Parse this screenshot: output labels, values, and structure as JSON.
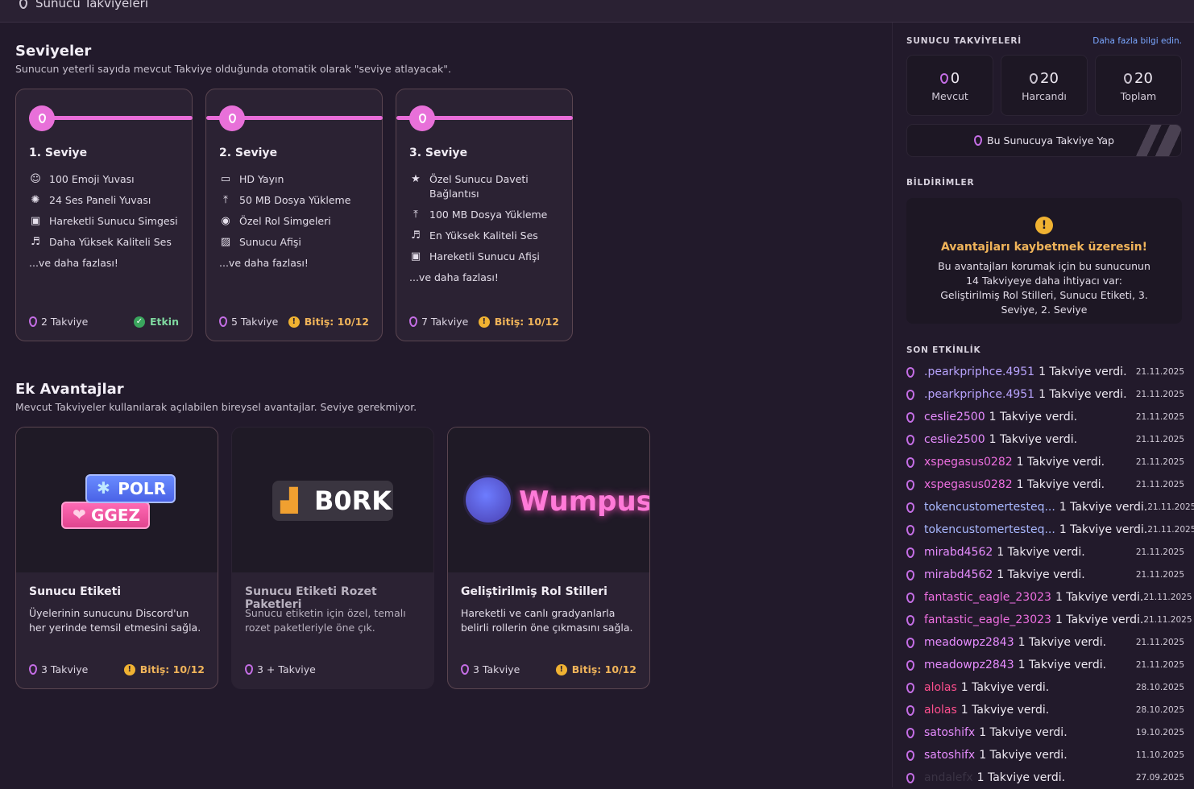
{
  "header": {
    "title": "Sunucu Takviyeleri"
  },
  "levels": {
    "title": "Seviyeler",
    "subtitle": "Sunucun yeterli sayıda mevcut Takviye olduğunda otomatik olarak \"seviye atlayacak\".",
    "cards": [
      {
        "name": "1. Seviye",
        "perks": [
          {
            "icon": "emoji-icon",
            "text": "100 Emoji Yuvası"
          },
          {
            "icon": "soundboard-icon",
            "text": "24 Ses Paneli Yuvası"
          },
          {
            "icon": "gif-icon",
            "text": "Hareketli Sunucu Simgesi"
          },
          {
            "icon": "headphones-icon",
            "text": "Daha Yüksek Kaliteli Ses"
          }
        ],
        "more": "...ve daha fazlası!",
        "boosts": "2 Takviye",
        "status": "Etkin"
      },
      {
        "name": "2. Seviye",
        "perks": [
          {
            "icon": "screen-share-icon",
            "text": "HD Yayın"
          },
          {
            "icon": "upload-icon",
            "text": "50 MB Dosya Yükleme"
          },
          {
            "icon": "role-icon",
            "text": "Özel Rol Simgeleri"
          },
          {
            "icon": "image-icon",
            "text": "Sunucu Afişi"
          }
        ],
        "more": "...ve daha fazlası!",
        "boosts": "5 Takviye",
        "status": "Bitiş: 10/12"
      },
      {
        "name": "3. Seviye",
        "perks": [
          {
            "icon": "star-icon",
            "text": "Özel Sunucu Daveti Bağlantısı"
          },
          {
            "icon": "upload-icon",
            "text": "100 MB Dosya Yükleme"
          },
          {
            "icon": "headphones-icon",
            "text": "En Yüksek Kaliteli Ses"
          },
          {
            "icon": "gif-icon",
            "text": "Hareketli Sunucu Afişi"
          }
        ],
        "more": "...ve daha fazlası!",
        "boosts": "7 Takviye",
        "status": "Bitiş: 10/12"
      }
    ]
  },
  "extras": {
    "title": "Ek Avantajlar",
    "subtitle": "Mevcut Takviyeler kullanılarak açılabilen bireysel avantajlar. Seviye gerekmiyor.",
    "cards": [
      {
        "title": "Sunucu Etiketi",
        "desc": "Üyelerinin sunucunu Discord'un her yerinde temsil etmesini sağla.",
        "boosts": "3 Takviye",
        "status": "Bitiş: 10/12",
        "tag1": "POLR",
        "tag2": "GGEZ"
      },
      {
        "title": "Sunucu Etiketi Rozet Paketleri",
        "desc": "Sunucu etiketin için özel, temalı rozet paketleriyle öne çık.",
        "boosts": "3 + Takviye",
        "tag": "B0RK"
      },
      {
        "title": "Geliştirilmiş Rol Stilleri",
        "desc": "Hareketli ve canlı gradyanlarla belirli rollerin öne çıkmasını sağla.",
        "boosts": "3 Takviye",
        "status": "Bitiş: 10/12",
        "tag": "Wumpus"
      }
    ]
  },
  "sidebar": {
    "boosts_title": "SUNUCU TAKVİYELERİ",
    "learn_more": "Daha fazla bilgi edin.",
    "stats": [
      {
        "value": "0",
        "label": "Mevcut"
      },
      {
        "value": "20",
        "label": "Harcandı"
      },
      {
        "value": "20",
        "label": "Toplam"
      }
    ],
    "boost_button": "Bu Sunucuya Takviye Yap",
    "notif_title": "BİLDİRİMLER",
    "notif_heading": "Avantajları kaybetmek üzeresin!",
    "notif_text": "Bu avantajları korumak için bu sunucunun 14 Takviyeye daha ihtiyacı var: Geliştirilmiş Rol Stilleri, Sunucu Etiketi, 3. Seviye, 2. Seviye",
    "activity_title": "SON ETKİNLİK",
    "activity": [
      {
        "user": ".pearkpriphce.4951",
        "msg": "1 Takviye verdi.",
        "date": "21.11.2025",
        "color": "#b9a4ff"
      },
      {
        "user": ".pearkpriphce.4951",
        "msg": "1 Takviye verdi.",
        "date": "21.11.2025",
        "color": "#b9a4ff"
      },
      {
        "user": "ceslie2500",
        "msg": "1 Takviye verdi.",
        "date": "21.11.2025",
        "color": "#e78cff"
      },
      {
        "user": "ceslie2500",
        "msg": "1 Takviye verdi.",
        "date": "21.11.2025",
        "color": "#e78cff"
      },
      {
        "user": "xspegasus0282",
        "msg": "1 Takviye verdi.",
        "date": "21.11.2025",
        "color": "#ee6fe0"
      },
      {
        "user": "xspegasus0282",
        "msg": "1 Takviye verdi.",
        "date": "21.11.2025",
        "color": "#ee6fe0"
      },
      {
        "user": "tokencustomertesteq...",
        "msg": "1 Takviye verdi.",
        "date": "21.11.2025",
        "color": "#a9b8ff"
      },
      {
        "user": "tokencustomertesteq...",
        "msg": "1 Takviye verdi.",
        "date": "21.11.2025",
        "color": "#a9b8ff"
      },
      {
        "user": "mirabd4562",
        "msg": "1 Takviye verdi.",
        "date": "21.11.2025",
        "color": "#e78cff"
      },
      {
        "user": "mirabd4562",
        "msg": "1 Takviye verdi.",
        "date": "21.11.2025",
        "color": "#e78cff"
      },
      {
        "user": "fantastic_eagle_23023",
        "msg": "1 Takviye verdi.",
        "date": "21.11.2025",
        "color": "#ee6fe0"
      },
      {
        "user": "fantastic_eagle_23023",
        "msg": "1 Takviye verdi.",
        "date": "21.11.2025",
        "color": "#ee6fe0"
      },
      {
        "user": "meadowpz2843",
        "msg": "1 Takviye verdi.",
        "date": "21.11.2025",
        "color": "#e78cff"
      },
      {
        "user": "meadowpz2843",
        "msg": "1 Takviye verdi.",
        "date": "21.11.2025",
        "color": "#e78cff"
      },
      {
        "user": "alolas",
        "msg": "1 Takviye verdi.",
        "date": "28.10.2025",
        "color": "#ff4f8e"
      },
      {
        "user": "alolas",
        "msg": "1 Takviye verdi.",
        "date": "28.10.2025",
        "color": "#ff4f8e"
      },
      {
        "user": "satoshifx",
        "msg": "1 Takviye verdi.",
        "date": "19.10.2025",
        "color": "#e78cff"
      },
      {
        "user": "satoshifx",
        "msg": "1 Takviye verdi.",
        "date": "11.10.2025",
        "color": "#e78cff"
      },
      {
        "user": "andalefx",
        "msg": "1 Takviye verdi.",
        "date": "27.09.2025",
        "color": "#3a3344"
      }
    ]
  }
}
